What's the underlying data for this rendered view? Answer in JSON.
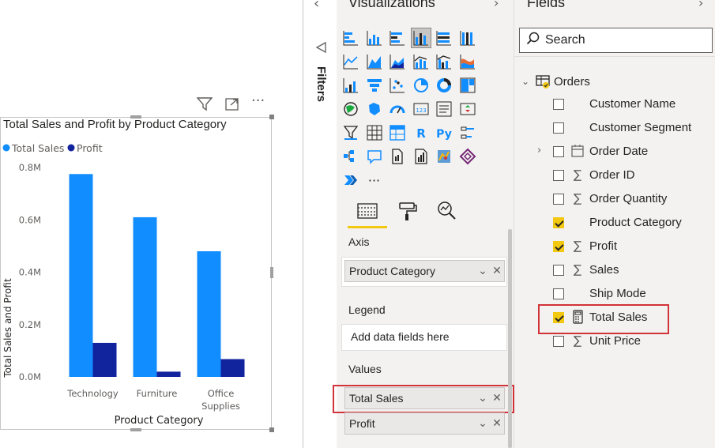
{
  "chart": {
    "title": "Total Sales and Profit by Product Category",
    "legend": [
      "Total Sales",
      "Profit"
    ],
    "xlabel": "Product Category",
    "ylabel": "Total Sales and Profit"
  },
  "chart_data": {
    "type": "bar",
    "title": "Total Sales and Profit by Product Category",
    "categories": [
      "Technology",
      "Furniture",
      "Office Supplies"
    ],
    "category_lines": [
      [
        "Technology"
      ],
      [
        "Furniture"
      ],
      [
        "Office",
        "Supplies"
      ]
    ],
    "series": [
      {
        "name": "Total Sales",
        "values": [
          0.775,
          0.61,
          0.48
        ],
        "color": "#118dff"
      },
      {
        "name": "Profit",
        "values": [
          0.13,
          0.02,
          0.068
        ],
        "color": "#12239e"
      }
    ],
    "yticks": [
      "0.0M",
      "0.2M",
      "0.4M",
      "0.6M",
      "0.8M"
    ],
    "ylim": [
      0,
      0.8
    ],
    "units": "M",
    "xlabel": "Product Category",
    "ylabel": "Total Sales and Profit",
    "legend_position": "top-left",
    "grid": false
  },
  "filters": {
    "label": "Filters"
  },
  "visualizations": {
    "title": "Visualizations",
    "more_label": "···",
    "icons": [
      "stacked-bar-chart-icon",
      "stacked-column-chart-icon",
      "clustered-bar-chart-icon",
      "clustered-column-chart-icon",
      "100-stacked-bar-chart-icon",
      "100-stacked-column-chart-icon",
      "line-chart-icon",
      "area-chart-icon",
      "stacked-area-chart-icon",
      "line-and-stacked-column-icon",
      "line-and-clustered-column-icon",
      "ribbon-chart-icon",
      "waterfall-chart-icon",
      "funnel-icon",
      "scatter-chart-icon",
      "pie-chart-icon",
      "donut-chart-icon",
      "treemap-icon",
      "map-icon",
      "filled-map-icon",
      "gauge-icon",
      "card-icon",
      "multi-row-card-icon",
      "kpi-icon",
      "slicer-icon",
      "table-icon",
      "matrix-icon",
      "r-visual-icon",
      "python-visual-icon",
      "key-influencers-icon",
      "decomposition-tree-icon",
      "qa-icon",
      "paginated-report-icon",
      "arcgis-icon",
      "power-apps-icon",
      "power-automate-icon",
      "more-visuals-icon"
    ],
    "wells": {
      "axis": {
        "label": "Axis",
        "field": "Product Category"
      },
      "legend": {
        "label": "Legend",
        "placeholder": "Add data fields here"
      },
      "values": {
        "label": "Values",
        "fields": [
          "Total Sales",
          "Profit"
        ]
      }
    },
    "chip_controls": {
      "chevron": "⌄",
      "remove": "✕"
    }
  },
  "fields": {
    "title": "Fields",
    "search_placeholder": "Search",
    "table": "Orders",
    "items": [
      {
        "name": "Customer Name",
        "checked": false,
        "icon": ""
      },
      {
        "name": "Customer Segment",
        "checked": false,
        "icon": ""
      },
      {
        "name": "Order Date",
        "checked": false,
        "icon": "calendar",
        "expandable": true
      },
      {
        "name": "Order ID",
        "checked": false,
        "icon": "sigma"
      },
      {
        "name": "Order Quantity",
        "checked": false,
        "icon": "sigma"
      },
      {
        "name": "Product Category",
        "checked": true,
        "icon": ""
      },
      {
        "name": "Profit",
        "checked": true,
        "icon": "sigma"
      },
      {
        "name": "Sales",
        "checked": false,
        "icon": "sigma"
      },
      {
        "name": "Ship Mode",
        "checked": false,
        "icon": ""
      },
      {
        "name": "Total Sales",
        "checked": true,
        "icon": "calculator"
      },
      {
        "name": "Unit Price",
        "checked": false,
        "icon": "sigma"
      }
    ]
  },
  "colors": {
    "accent": "#f2c811",
    "highlight": "#d13438",
    "series1": "#118dff",
    "series2": "#12239e"
  }
}
